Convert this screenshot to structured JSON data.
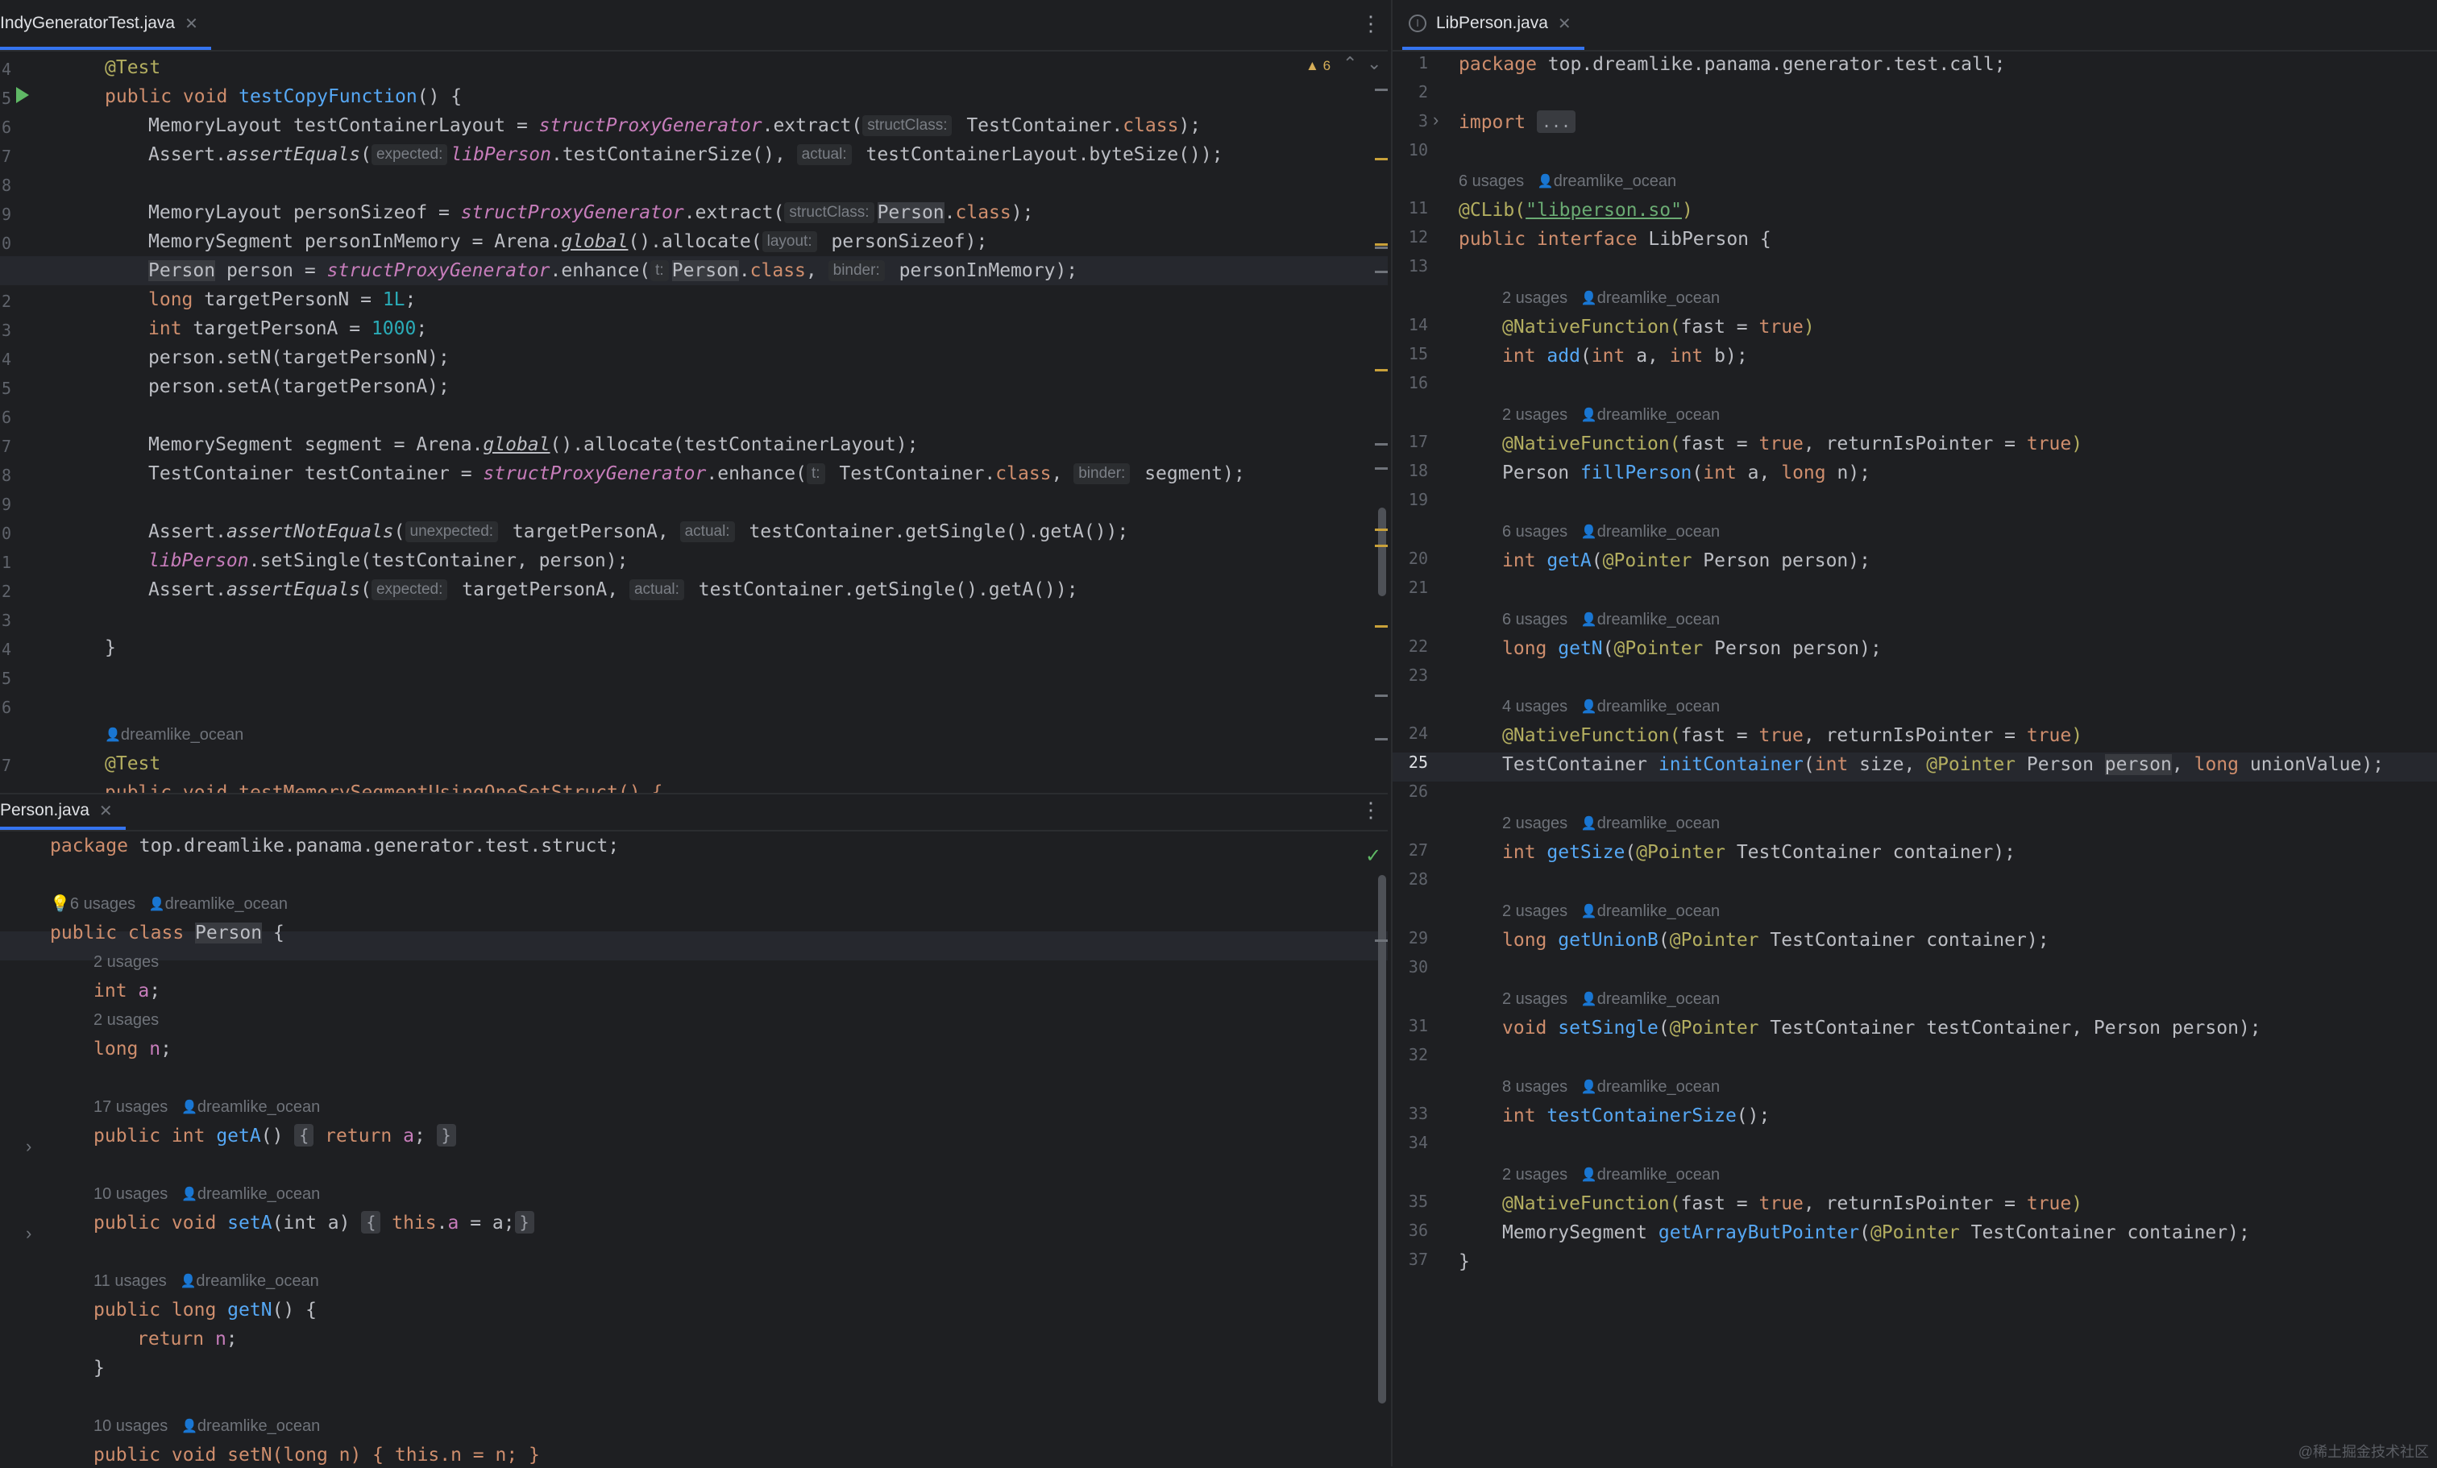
{
  "tabs": {
    "top_left": "IndyGeneratorTest.java",
    "bottom_left": "Person.java",
    "right": "LibPerson.java"
  },
  "inspection": {
    "warnings": "6"
  },
  "left_top": {
    "line_numbers": [
      "4",
      "5",
      "6",
      "7",
      "8",
      "9",
      "0",
      "1",
      "2",
      "3",
      "4",
      "5",
      "6",
      "7",
      "8",
      "9",
      "0",
      "1",
      "2",
      "3",
      "4",
      "5",
      "6",
      "7"
    ],
    "author": "dreamlike_ocean",
    "l1": {
      "a": "@Test"
    },
    "l2": {
      "a": "public void ",
      "b": "testCopyFunction",
      "c": "() {"
    },
    "l3": {
      "a": "MemoryLayout testContainerLayout = ",
      "b": "structProxyGenerator",
      "c": ".extract(",
      "h": "structClass:",
      "d": " TestContainer.",
      "e": "class",
      "f": ");"
    },
    "l4": {
      "a": "Assert.",
      "b": "assertEquals",
      "c": "(",
      "h1": "expected:",
      "d": " ",
      "e": "libPerson",
      "f": ".testContainerSize(), ",
      "h2": "actual:",
      "g": " testContainerLayout.byteSize());"
    },
    "l6": {
      "a": "MemoryLayout personSizeof = ",
      "b": "structProxyGenerator",
      "c": ".extract(",
      "h": "structClass:",
      "d": " ",
      "e": "Person",
      "f": ".",
      "g": "class",
      "i": ");"
    },
    "l7": {
      "a": "MemorySegment personInMemory = Arena.",
      "b": "global",
      "c": "().allocate(",
      "h": "layout:",
      "d": " personSizeof);"
    },
    "l8": {
      "a": "Person",
      "b": " person = ",
      "c": "structProxyGenerator",
      "d": ".enhance(",
      "h1": "t:",
      "e": " ",
      "f": "Person",
      "g": ".",
      "i": "class",
      "j": ", ",
      "h2": "binder:",
      "k": " personInMemory);"
    },
    "l9": {
      "a": "long ",
      "b": "targetPersonN = ",
      "c": "1L",
      "d": ";"
    },
    "l10": {
      "a": "int ",
      "b": "targetPersonA = ",
      "c": "1000",
      "d": ";"
    },
    "l11": {
      "a": "person.setN(targetPersonN);"
    },
    "l12": {
      "a": "person.setA(targetPersonA);"
    },
    "l14": {
      "a": "MemorySegment segment = Arena.",
      "b": "global",
      "c": "().allocate(testContainerLayout);"
    },
    "l15": {
      "a": "TestContainer testContainer = ",
      "b": "structProxyGenerator",
      "c": ".enhance(",
      "h1": "t:",
      "d": " TestContainer.",
      "e": "class",
      "f": ", ",
      "h2": "binder:",
      "g": " segment);"
    },
    "l17": {
      "a": "Assert.",
      "b": "assertNotEquals",
      "c": "(",
      "h1": "unexpected:",
      "d": " targetPersonA, ",
      "h2": "actual:",
      "e": " testContainer.getSingle().getA());"
    },
    "l18": {
      "a": "libPerson",
      "b": ".setSingle(testContainer, person);"
    },
    "l19": {
      "a": "Assert.",
      "b": "assertEquals",
      "c": "(",
      "h1": "expected:",
      "d": " targetPersonA, ",
      "h2": "actual:",
      "e": " testContainer.getSingle().getA());"
    },
    "l21": {
      "a": "}"
    },
    "l25": {
      "a": "@Test"
    },
    "l26": {
      "a": "public void testMemorySegmentUsingOneSetStruct() {"
    }
  },
  "left_bottom": {
    "author": "dreamlike_ocean",
    "pkg": {
      "a": "package ",
      "b": "top.dreamlike.panama.generator.test.struct;"
    },
    "class_usages": "6 usages",
    "cls": {
      "a": "public class ",
      "b": "Person",
      "c": " {"
    },
    "u_a": "2 usages",
    "fa": {
      "a": "int ",
      "b": "a",
      "c": ";"
    },
    "u_n": "2 usages",
    "fn": {
      "a": "long ",
      "b": "n",
      "c": ";"
    },
    "u_getA": "17 usages",
    "getA": {
      "a": "public int ",
      "b": "getA",
      "c": "() ",
      "f1": "{",
      "d": " return ",
      "e": "a",
      "g": ";",
      "f2": "}"
    },
    "u_setA": "10 usages",
    "setA": {
      "a": "public void ",
      "b": "setA",
      "c": "(int a) ",
      "f1": "{",
      "d": " this",
      "e": ".",
      "g": "a",
      "h": " = a;",
      "f2": "}"
    },
    "u_getN": "11 usages",
    "getN": {
      "a": "public long ",
      "b": "getN",
      "c": "() {"
    },
    "getN_body": {
      "a": "return ",
      "b": "n",
      "c": ";"
    },
    "close": "}",
    "u_setN": "10 usages",
    "setN": {
      "a": "public void setN(long n) { this.n = n; }"
    }
  },
  "right": {
    "line_numbers": [
      "1",
      "2",
      "3",
      "10",
      "11",
      "12",
      "13",
      "14",
      "15",
      "16",
      "17",
      "18",
      "19",
      "20",
      "21",
      "22",
      "23",
      "24",
      "25",
      "26",
      "27",
      "28",
      "29",
      "30",
      "31",
      "32",
      "33",
      "34",
      "35",
      "36",
      "37"
    ],
    "author": "dreamlike_ocean",
    "pkg": {
      "a": "package ",
      "b": "top.dreamlike.panama.generator.test.call;"
    },
    "imp": {
      "a": "import ",
      "b": "..."
    },
    "iface_usages": "6 usages",
    "clib": {
      "a": "@CLib(",
      "b": "\"libperson.so\"",
      "c": ")"
    },
    "iface": {
      "a": "public interface ",
      "b": "LibPerson {"
    },
    "m1_usages": "2 usages",
    "m1_ann": {
      "a": "@NativeFunction(",
      "b": "fast = ",
      "c": "true",
      "d": ")"
    },
    "m1": {
      "a": "int ",
      "b": "add",
      "c": "(",
      "d": "int ",
      "e": "a, ",
      "f": "int ",
      "g": "b);"
    },
    "m2_usages": "2 usages",
    "m2_ann": {
      "a": "@NativeFunction(",
      "b": "fast = ",
      "c": "true",
      "d": ", returnIsPointer = ",
      "e": "true",
      "f": ")"
    },
    "m2": {
      "a": "Person ",
      "b": "fillPerson",
      "c": "(",
      "d": "int ",
      "e": "a, ",
      "f": "long ",
      "g": "n);"
    },
    "m3_usages": "6 usages",
    "m3": {
      "a": "int ",
      "b": "getA",
      "c": "(",
      "d": "@Pointer",
      "e": " Person person);"
    },
    "m4_usages": "6 usages",
    "m4": {
      "a": "long ",
      "b": "getN",
      "c": "(",
      "d": "@Pointer",
      "e": " Person person);"
    },
    "m5_usages": "4 usages",
    "m5_ann": {
      "a": "@NativeFunction(",
      "b": "fast = ",
      "c": "true",
      "d": ", returnIsPointer = ",
      "e": "true",
      "f": ")"
    },
    "m5": {
      "a": "TestContainer ",
      "b": "initContainer",
      "c": "(",
      "d": "int ",
      "e": "size, ",
      "f": "@Pointer",
      "g": " Person ",
      "h": "person",
      "i": ", ",
      "j": "long ",
      "k": "unionValue);"
    },
    "m6_usages": "2 usages",
    "m6": {
      "a": "int ",
      "b": "getSize",
      "c": "(",
      "d": "@Pointer",
      "e": " TestContainer container);"
    },
    "m7_usages": "2 usages",
    "m7": {
      "a": "long ",
      "b": "getUnionB",
      "c": "(",
      "d": "@Pointer",
      "e": " TestContainer container);"
    },
    "m8_usages": "2 usages",
    "m8": {
      "a": "void ",
      "b": "setSingle",
      "c": "(",
      "d": "@Pointer",
      "e": " TestContainer testContainer, Person person);"
    },
    "m9_usages": "8 usages",
    "m9": {
      "a": "int ",
      "b": "testContainerSize",
      "c": "();"
    },
    "m10_usages": "2 usages",
    "m10_ann": {
      "a": "@NativeFunction(",
      "b": "fast = ",
      "c": "true",
      "d": ", returnIsPointer = ",
      "e": "true",
      "f": ")"
    },
    "m10": {
      "a": "MemorySegment ",
      "b": "getArrayButPointer",
      "c": "(",
      "d": "@Pointer",
      "e": " TestContainer container);"
    },
    "close": "}"
  },
  "watermark": "@稀土掘金技术社区",
  "colors": {
    "keyword": "#cf8e6d",
    "function": "#56a8f5",
    "number": "#2aacb8",
    "string": "#6aab73",
    "annotation": "#b3ae60",
    "static_field": "#c77dbb",
    "accent": "#3574f0"
  }
}
